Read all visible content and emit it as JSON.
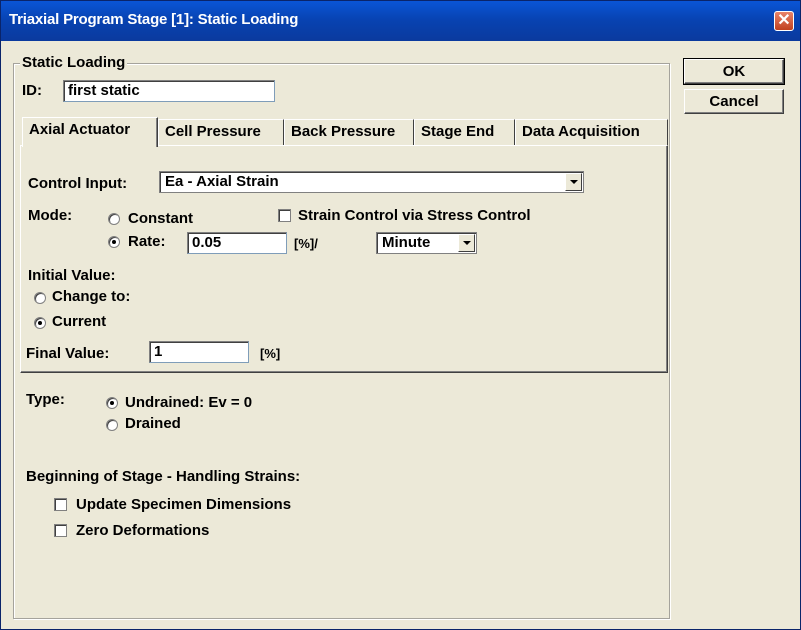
{
  "window": {
    "title": "Triaxial Program Stage [1]: Static Loading"
  },
  "group": {
    "legend": "Static Loading"
  },
  "id_field": {
    "label": "ID:",
    "value": "first static"
  },
  "buttons": {
    "ok": "OK",
    "cancel": "Cancel"
  },
  "tabs": [
    "Axial Actuator",
    "Cell Pressure",
    "Back Pressure",
    "Stage End",
    "Data Acquisition"
  ],
  "active_tab": "Axial Actuator",
  "control_input": {
    "label": "Control Input:",
    "selected": "Ea - Axial Strain"
  },
  "mode": {
    "label": "Mode:",
    "constant_label": "Constant",
    "rate_label": "Rate:",
    "rate_value": "0.05",
    "rate_unit": "[%]/",
    "rate_period": "Minute",
    "selected": "Rate",
    "strain_control_label": "Strain Control via Stress Control",
    "strain_control_checked": false
  },
  "initial_value": {
    "label": "Initial Value:",
    "change_to_label": "Change to:",
    "current_label": "Current",
    "selected": "Current"
  },
  "final_value": {
    "label": "Final Value:",
    "value": "1",
    "unit": "[%]"
  },
  "type": {
    "label": "Type:",
    "undrained_label": "Undrained:  Ev = 0",
    "drained_label": "Drained",
    "selected": "Undrained"
  },
  "beginning": {
    "heading": "Beginning of Stage - Handling Strains:",
    "update_dims_label": "Update Specimen Dimensions",
    "update_dims_checked": false,
    "zero_def_label": "Zero Deformations",
    "zero_def_checked": false
  },
  "icons": {
    "close": "close-icon"
  }
}
